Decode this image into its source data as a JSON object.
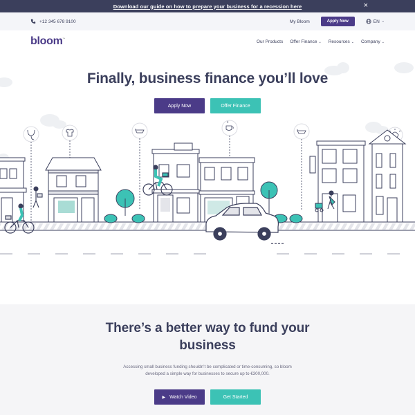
{
  "banner": {
    "text": "Download our guide on how to prepare your business for a recession here",
    "close_icon": "×"
  },
  "topbar": {
    "phone": "+12 345 678 9100",
    "my_bloom": "My Bloom",
    "apply": "Apply Now",
    "lang": "EN"
  },
  "nav": {
    "logo": "bloom",
    "items": [
      {
        "label": "Our Products"
      },
      {
        "label": "Offer Finance"
      },
      {
        "label": "Resources"
      },
      {
        "label": "Company"
      }
    ]
  },
  "hero": {
    "title": "Finally, business finance you’ll love",
    "apply": "Apply Now",
    "offer": "Offer Finance"
  },
  "section": {
    "title_line1": "There’s a better way to fund your",
    "title_line2": "business",
    "text_line1": "Accessing small business funding shouldn’t be complicated or time-consuming, so bloom",
    "text_line2": "developed a simple way for businesses to secure up to €300,000.",
    "watch": "Watch Video",
    "start": "Get Started"
  },
  "colors": {
    "purple": "#4b3b88",
    "teal": "#3cc2b5",
    "navy": "#3b3f5c"
  }
}
